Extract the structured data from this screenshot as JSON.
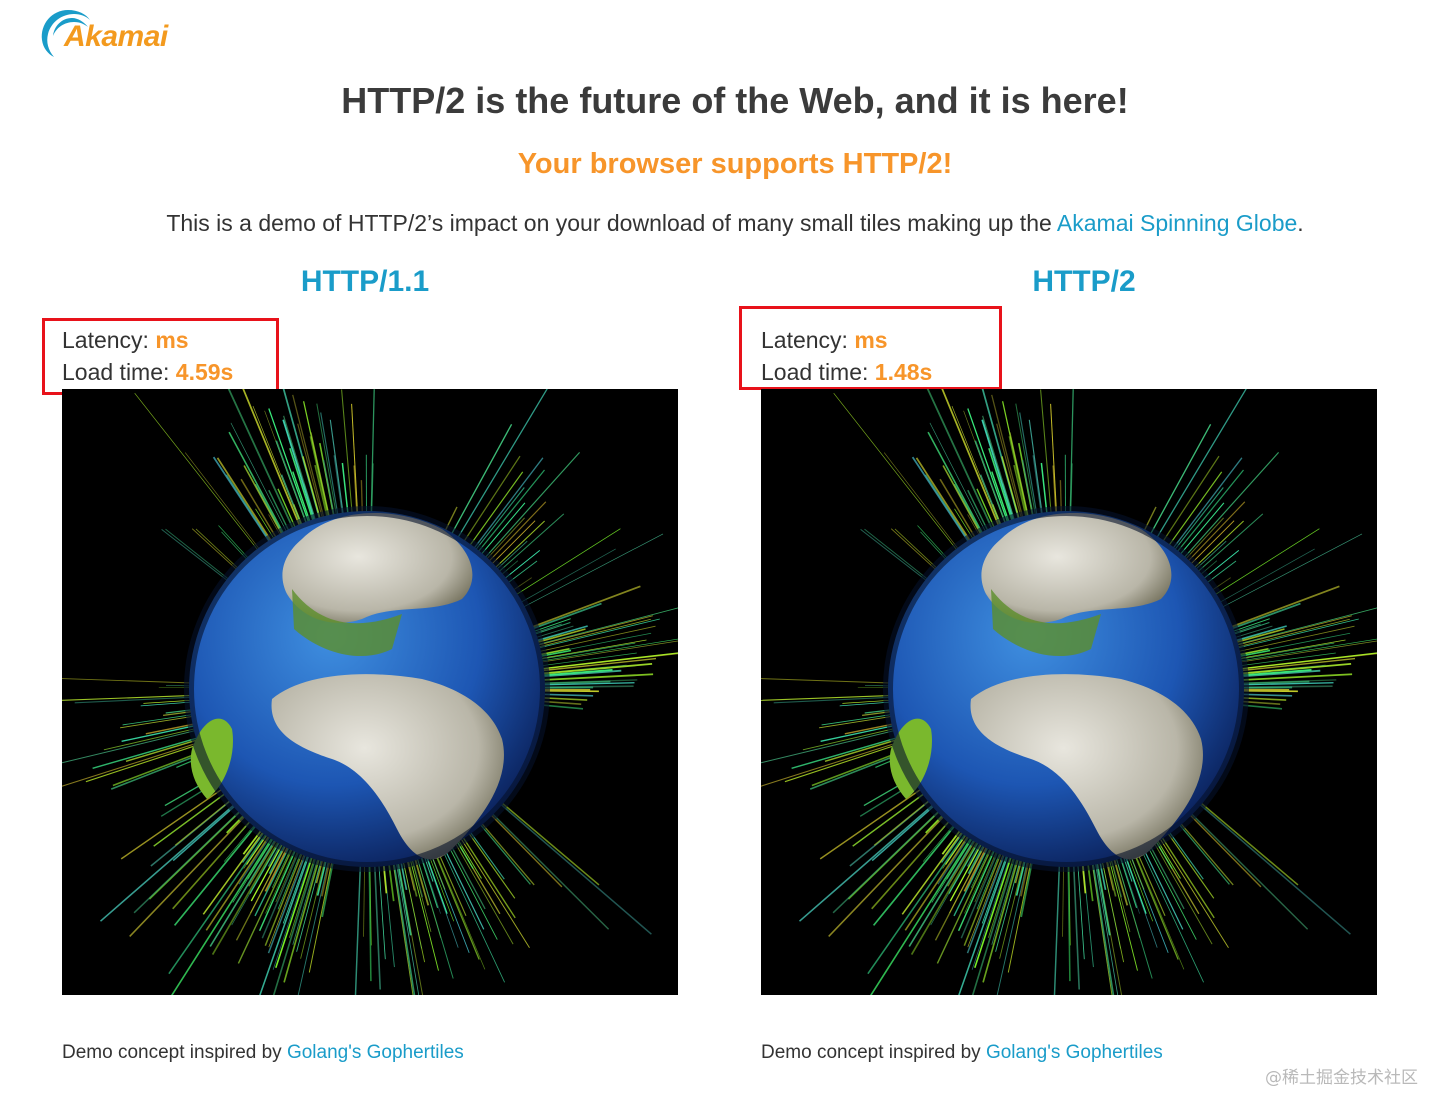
{
  "logo": {
    "text": "Akamai",
    "brand_color": "#f39a1e",
    "swoosh_color": "#1a9cc9"
  },
  "header": {
    "title": "HTTP/2 is the future of the Web, and it is here!",
    "subtitle": "Your browser supports HTTP/2!"
  },
  "intro": {
    "text_before": "This is a demo of HTTP/2’s impact on your download of many small tiles making up the ",
    "link_text": "Akamai Spinning Globe",
    "text_after": "."
  },
  "columns": [
    {
      "heading": "HTTP/1.1",
      "latency_label": "Latency: ",
      "latency_value": "ms",
      "load_label": "Load time: ",
      "load_value": "4.59s",
      "credit_text": "Demo concept inspired by ",
      "credit_link": "Golang's Gophertiles"
    },
    {
      "heading": "HTTP/2",
      "latency_label": "Latency: ",
      "latency_value": "ms",
      "load_label": "Load time: ",
      "load_value": "1.48s",
      "credit_text": "Demo concept inspired by ",
      "credit_link": "Golang's Gophertiles"
    }
  ],
  "colors": {
    "heading_blue": "#1a9cc9",
    "accent_orange": "#f7952a",
    "highlight_red": "#e8121a"
  },
  "watermark": "@稀土掘金技术社区"
}
